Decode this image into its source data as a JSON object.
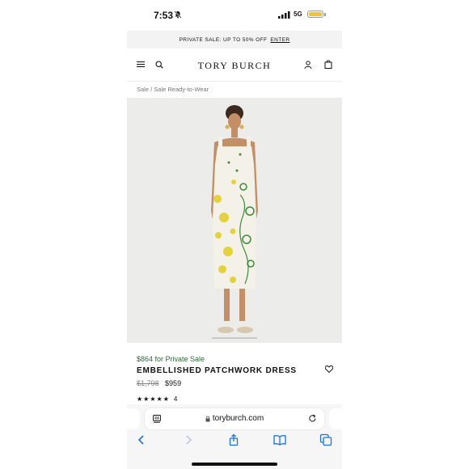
{
  "status_bar": {
    "time": "7:53",
    "network": "5G"
  },
  "promo": {
    "text": "PRIVATE SALE: UP TO 50% OFF",
    "cta": "ENTER"
  },
  "header": {
    "brand": "TORY BURCH"
  },
  "breadcrumb": {
    "items": [
      "Sale",
      "Sale Ready-to-Wear"
    ],
    "separator": "/"
  },
  "product": {
    "private_price": "$864 for Private Sale",
    "name": "EMBELLISHED PATCHWORK DRESS",
    "original_price": "$1,798",
    "sale_price": "$959",
    "stars": "★★★★★",
    "rating_count": "4"
  },
  "browser": {
    "url": "toryburch.com"
  },
  "icons": {
    "menu": "menu-icon",
    "search": "search-icon",
    "account": "account-icon",
    "bag": "bag-icon",
    "wishlist": "heart-icon",
    "reload": "reload-icon",
    "reader": "reader-icon",
    "lock": "lock-icon"
  },
  "colors": {
    "private_price": "#2f6b3d",
    "battery": "#f4c430"
  }
}
